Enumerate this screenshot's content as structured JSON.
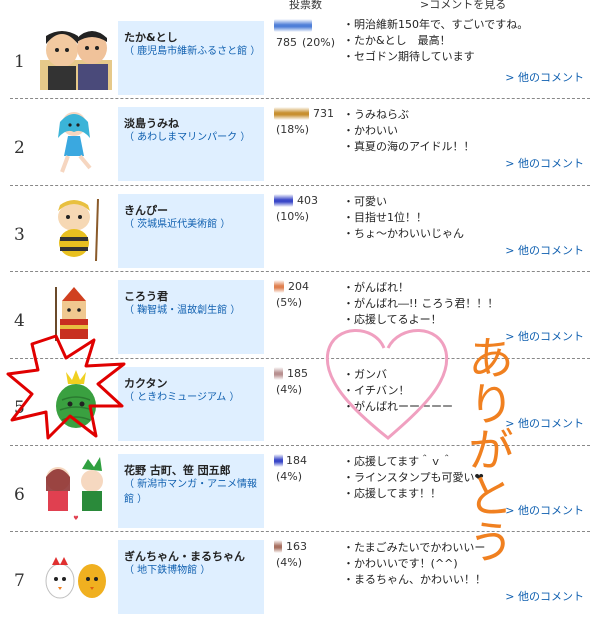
{
  "header": {
    "votes": "投票数",
    "see_comments": ">コメントを見る"
  },
  "more_label": "> 他のコメント",
  "rows": [
    {
      "rank": "1",
      "name": "たか&とし",
      "facility": "（ 鹿児島市維新ふるさと館 ）",
      "votes": "785",
      "pct": "(20%)",
      "bar_color": "#4f7fd8",
      "bar_fraction": 1.0,
      "comments": [
        "・明治維新150年で、すごいですね。",
        "・たか&とし　最高！",
        "・セゴドン期待しています"
      ]
    },
    {
      "rank": "2",
      "name": "淡島うみね",
      "facility": "（ あわしまマリンパーク ）",
      "votes": "731",
      "pct": "(18%)",
      "bar_color": "#c89030",
      "bar_fraction": 0.93,
      "comments": [
        "・うみねらぶ",
        "・かわいい",
        "・真夏の海のアイドル！！"
      ]
    },
    {
      "rank": "3",
      "name": "きんぴー",
      "facility": "（ 茨城県近代美術館 ）",
      "votes": "403",
      "pct": "(10%)",
      "bar_color": "#3a48c8",
      "bar_fraction": 0.51,
      "comments": [
        "・可愛い",
        "・目指せ1位！！",
        "・ちょ～かわいいじゃん"
      ]
    },
    {
      "rank": "4",
      "name": "ころう君",
      "facility": "（ 鞠智城・温故創生館 ）",
      "votes": "204",
      "pct": "(5%)",
      "bar_color": "#e08050",
      "bar_fraction": 0.26,
      "comments": [
        "・がんばれ！",
        "・がんばれ―!! ころう君！！！",
        "・応援してるよー！"
      ]
    },
    {
      "rank": "5",
      "name": "カクタン",
      "facility": "（ ときわミュージアム ）",
      "votes": "185",
      "pct": "(4%)",
      "bar_color": "#b89090",
      "bar_fraction": 0.24,
      "comments": [
        "・ガンバ",
        "・イチバン！",
        "・がんばれーーーーー"
      ]
    },
    {
      "rank": "6",
      "name": "花野 古町、笹 団五郎",
      "facility": "（ 新潟市マンガ・アニメ情報館 ）",
      "votes": "184",
      "pct": "(4%)",
      "bar_color": "#3a48c8",
      "bar_fraction": 0.23,
      "comments": [
        "・応援してます＾ｖ＾",
        "・ラインスタンプも可愛い❤",
        "・応援してます！！"
      ]
    },
    {
      "rank": "7",
      "name": "ぎんちゃん・まるちゃん",
      "facility": "（ 地下鉄博物館 ）",
      "votes": "163",
      "pct": "(4%)",
      "bar_color": "#a87060",
      "bar_fraction": 0.21,
      "comments": [
        "・たまごみたいでかわいいー",
        "・かわいいです！(^^)",
        "・まるちゃん、かわいい！！"
      ]
    }
  ],
  "annotation_text": "ありがとう",
  "colors": {
    "card_bg": "#dfefff",
    "link": "#1060b0",
    "star": "#e00000",
    "heart": "#f0a0c0",
    "handwriting": "#f08020"
  }
}
